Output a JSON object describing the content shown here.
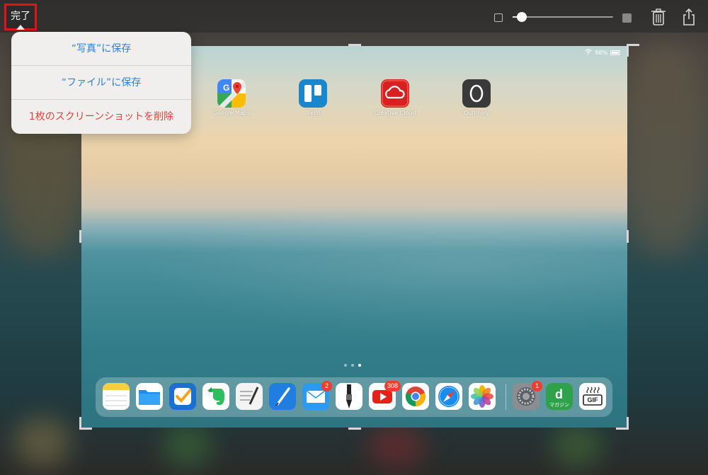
{
  "toolbar": {
    "done_label": "完了",
    "slider_value": 0.05,
    "icons": [
      "checkbox-icon",
      "trash-icon",
      "share-icon"
    ]
  },
  "menu": {
    "items": [
      {
        "label": "“写真”に保存",
        "style": "normal"
      },
      {
        "label": "“ファイル”に保存",
        "style": "normal"
      },
      {
        "label": "1枚のスクリーンショットを削除",
        "style": "destructive"
      }
    ]
  },
  "screenshot": {
    "status": {
      "battery": "98%"
    },
    "home_apps": [
      {
        "label": "Google Maps",
        "icon": "google-maps-icon"
      },
      {
        "label": "Trello",
        "icon": "trello-icon"
      },
      {
        "label": "Creative Cloud",
        "icon": "creative-cloud-icon"
      },
      {
        "label": "Outlinely",
        "icon": "outlinely-icon"
      }
    ],
    "page_indicator": {
      "pages": 3,
      "current": 3
    },
    "dock": {
      "apps": [
        {
          "icon": "notes-icon"
        },
        {
          "icon": "files-icon"
        },
        {
          "icon": "omnifocus-icon"
        },
        {
          "icon": "evernote-icon"
        },
        {
          "icon": "editorial-icon"
        },
        {
          "icon": "pen-app-icon"
        },
        {
          "icon": "mail-icon",
          "badge": "2"
        },
        {
          "icon": "pen-nib-app-icon"
        },
        {
          "icon": "youtube-icon",
          "badge": "308"
        },
        {
          "icon": "chrome-icon"
        },
        {
          "icon": "safari-icon"
        },
        {
          "icon": "photos-icon"
        },
        {
          "icon": "settings-icon",
          "badge": "1"
        },
        {
          "icon": "d-magazine-icon",
          "text": "マガジン"
        },
        {
          "icon": "gif-app-icon",
          "text": "GIF"
        }
      ]
    }
  },
  "colors": {
    "accent": "#2e7fd9",
    "destructive": "#e0413a",
    "highlight_border": "#e0141b"
  }
}
